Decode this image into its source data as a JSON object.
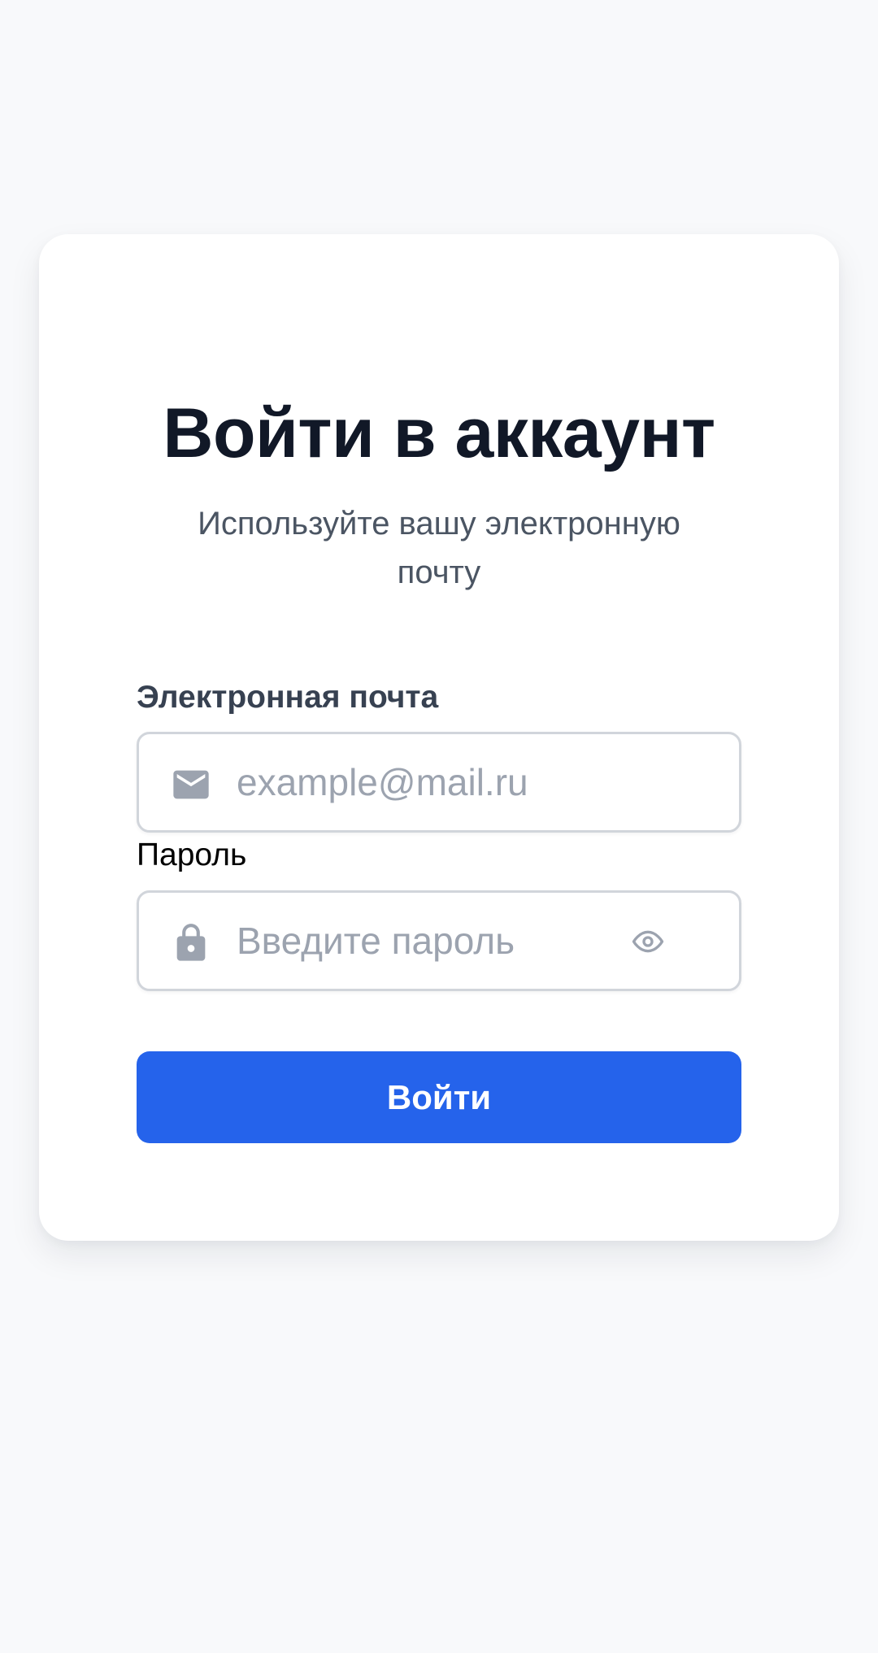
{
  "login": {
    "title": "Войти в аккаунт",
    "subtitle": "Используйте вашу электронную почту"
  },
  "form": {
    "email": {
      "label": "Электронная почта",
      "value": "",
      "placeholder": "example@mail.ru",
      "icon": "mail-icon"
    },
    "password": {
      "label": "Пароль",
      "value": "",
      "placeholder": "Введите пароль",
      "icon": "lock-icon",
      "toggle_icon": "eye-icon"
    },
    "submit_label": "Войти"
  },
  "colors": {
    "background": "#f8f9fb",
    "card": "#ffffff",
    "title": "#111827",
    "subtitle": "#4b5563",
    "input_border": "#d1d5db",
    "placeholder": "#9ca3af",
    "icon": "#9ca3af",
    "accent": "#2563eb"
  }
}
